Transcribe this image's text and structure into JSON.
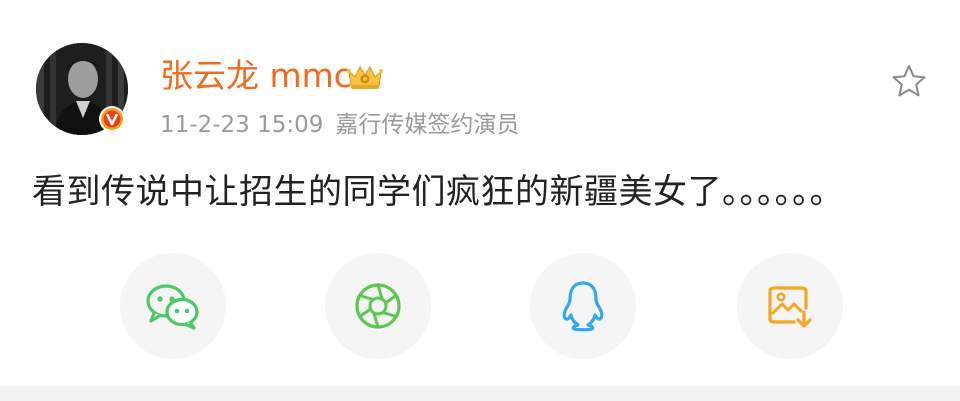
{
  "post": {
    "username": "张云龙 mmc",
    "timestamp": "11-2-23 15:09",
    "source": "嘉行传媒签约演员",
    "content": "看到传说中让招生的同学们疯狂的新疆美女了。。。。。。"
  },
  "icons": {
    "verified": "verified-badge-icon",
    "member": "crown-icon",
    "favorite": "star-icon"
  },
  "share": [
    {
      "name": "wechat",
      "icon": "wechat-icon",
      "color": "#4cc866"
    },
    {
      "name": "moments",
      "icon": "moments-icon",
      "color": "#5ac84f"
    },
    {
      "name": "qq",
      "icon": "qq-icon",
      "color": "#2fa9f0"
    },
    {
      "name": "save-image",
      "icon": "save-image-icon",
      "color": "#f5a623"
    }
  ],
  "colors": {
    "username": "#f26a1b",
    "meta": "#9a9a9a",
    "text": "#222222"
  }
}
